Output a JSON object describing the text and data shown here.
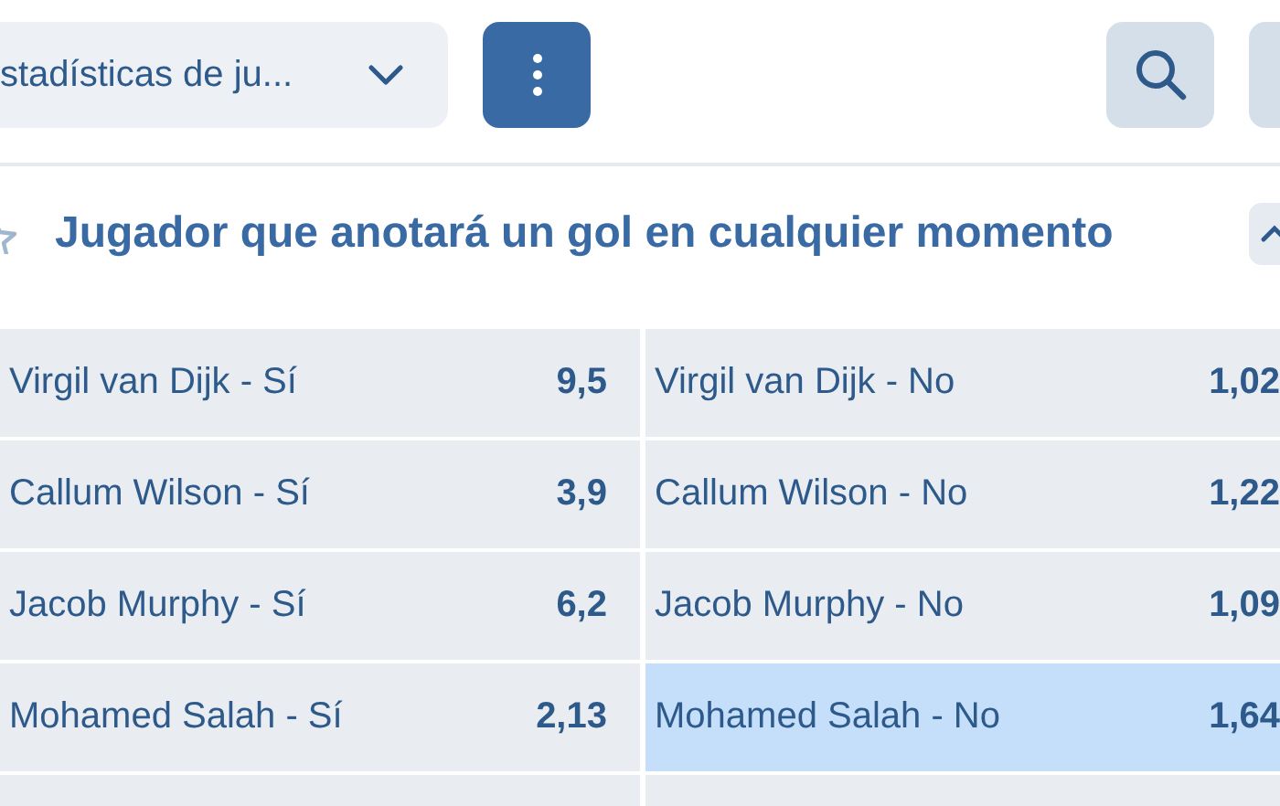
{
  "toolbar": {
    "dropdown": {
      "value": "stadísticas de ju..."
    }
  },
  "market": {
    "title": "Jugador que anotará un gol en cualquier momento",
    "favorite": false,
    "expanded": true
  },
  "outcomes": [
    {
      "name": "Virgil van Dijk - Sí",
      "odds": "9,5",
      "selected": false
    },
    {
      "name": "Virgil van Dijk - No",
      "odds": "1,02",
      "selected": false
    },
    {
      "name": "Callum Wilson - Sí",
      "odds": "3,9",
      "selected": false
    },
    {
      "name": "Callum Wilson - No",
      "odds": "1,22",
      "selected": false
    },
    {
      "name": "Jacob Murphy - Sí",
      "odds": "6,2",
      "selected": false
    },
    {
      "name": "Jacob Murphy - No",
      "odds": "1,09",
      "selected": false
    },
    {
      "name": "Mohamed Salah - Sí",
      "odds": "2,13",
      "selected": false
    },
    {
      "name": "Mohamed Salah - No",
      "odds": "1,64",
      "selected": true
    }
  ]
}
